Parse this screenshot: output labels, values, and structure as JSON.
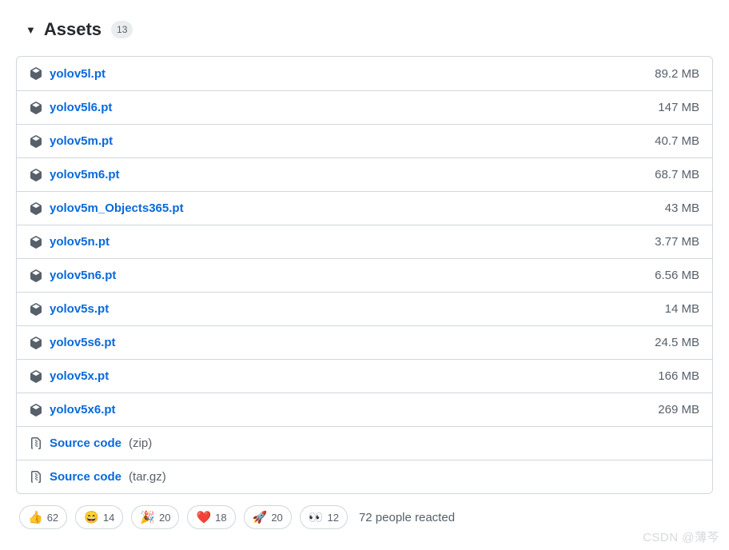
{
  "header": {
    "title": "Assets",
    "count": "13"
  },
  "assets": [
    {
      "name": "yolov5l.pt",
      "size": "89.2 MB",
      "type": "package"
    },
    {
      "name": "yolov5l6.pt",
      "size": "147 MB",
      "type": "package"
    },
    {
      "name": "yolov5m.pt",
      "size": "40.7 MB",
      "type": "package"
    },
    {
      "name": "yolov5m6.pt",
      "size": "68.7 MB",
      "type": "package"
    },
    {
      "name": "yolov5m_Objects365.pt",
      "size": "43 MB",
      "type": "package"
    },
    {
      "name": "yolov5n.pt",
      "size": "3.77 MB",
      "type": "package"
    },
    {
      "name": "yolov5n6.pt",
      "size": "6.56 MB",
      "type": "package"
    },
    {
      "name": "yolov5s.pt",
      "size": "14 MB",
      "type": "package"
    },
    {
      "name": "yolov5s6.pt",
      "size": "24.5 MB",
      "type": "package"
    },
    {
      "name": "yolov5x.pt",
      "size": "166 MB",
      "type": "package"
    },
    {
      "name": "yolov5x6.pt",
      "size": "269 MB",
      "type": "package"
    },
    {
      "name": "Source code",
      "format": "(zip)",
      "type": "zip"
    },
    {
      "name": "Source code",
      "format": "(tar.gz)",
      "type": "zip"
    }
  ],
  "reactions": [
    {
      "emoji": "👍",
      "count": "62"
    },
    {
      "emoji": "😄",
      "count": "14"
    },
    {
      "emoji": "🎉",
      "count": "20"
    },
    {
      "emoji": "❤️",
      "count": "18"
    },
    {
      "emoji": "🚀",
      "count": "20"
    },
    {
      "emoji": "👀",
      "count": "12"
    }
  ],
  "reactions_summary": "72 people reacted",
  "watermark": "CSDN @薄芩"
}
